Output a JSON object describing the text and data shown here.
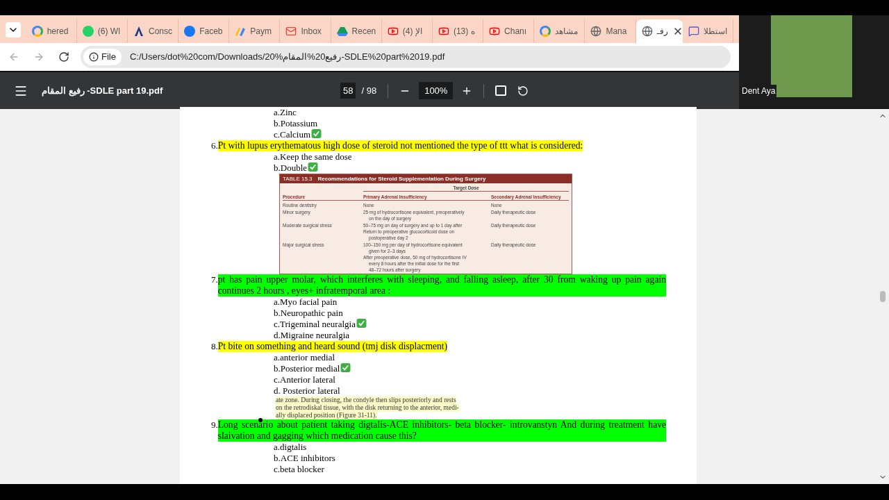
{
  "browser": {
    "tabs": [
      {
        "label": "hered",
        "selected": false
      },
      {
        "label": "(6) Wl",
        "selected": false
      },
      {
        "label": "Consc",
        "selected": false
      },
      {
        "label": "Faceb",
        "selected": false
      },
      {
        "label": "Paym",
        "selected": false
      },
      {
        "label": "Inbox",
        "selected": false
      },
      {
        "label": "Recen",
        "selected": false
      },
      {
        "label": "الإ (4)",
        "selected": false
      },
      {
        "label": "(13) ه",
        "selected": false
      },
      {
        "label": "Chanı",
        "selected": false
      },
      {
        "label": "مشاهد",
        "selected": false
      },
      {
        "label": "Mana",
        "selected": false
      },
      {
        "label": "رفـ",
        "selected": true
      },
      {
        "label": "استطلا",
        "selected": false
      }
    ],
    "address": {
      "scheme": "File",
      "url": "C:/Users/dot%20com/Downloads/20%رفيع20%المقام-SDLE%20part%2019.pdf"
    }
  },
  "viewer": {
    "title": "رفيع المقام -SDLE part 19.pdf",
    "page": "58",
    "page_total": "/ 98",
    "zoom": "100%"
  },
  "webcam": {
    "name": "Dent Aya"
  },
  "document": [
    {
      "kind": "option",
      "text": "a.Zinc",
      "correct": false
    },
    {
      "kind": "option",
      "text": "b.Potassium",
      "correct": false
    },
    {
      "kind": "option",
      "text": "c.Calcium",
      "correct": true
    },
    {
      "kind": "question",
      "number": "6.",
      "text": "Pt with lupus erythematous high dose of steroid not mentioned the type of ttt what is considered:",
      "color": "#ffff00"
    },
    {
      "kind": "option",
      "text": "a.Keep the same dose",
      "correct": false
    },
    {
      "kind": "option",
      "text": "b.Double",
      "correct": true
    },
    {
      "kind": "table",
      "title_label": "TABLE 15.3",
      "title": "Recommendations for Steroid Supplementation During Surgery",
      "group_heading": "Target Dose",
      "columns": [
        "Procedure",
        "Primary Adrenal Insufficiency",
        "Secondary Adrenal Insufficiency"
      ],
      "rows": [
        {
          "procedure": "Routine dentistry",
          "primary": [
            "None"
          ],
          "secondary": "None"
        },
        {
          "procedure": "Minor surgery",
          "primary": [
            "25 mg of hydrocortisone equivalent, preoperatively on the day of surgery"
          ],
          "secondary": "Daily therapeutic dose"
        },
        {
          "procedure": "Moderate surgical stress",
          "primary": [
            "50–75 mg on day of surgery and up to 1 day after",
            "Return to preoperative glucocorticoid dose on postoperative day 2"
          ],
          "secondary": "Daily therapeutic dose"
        },
        {
          "procedure": "Major surgical stress",
          "primary": [
            "100–150 mg per day of hydrocortisone equivalent given for 2–3 days",
            "After preoperative dose, 50 mg of hydrocortisone IV every 8 hours after the initial dose for the first 48–72 hours after surgery"
          ],
          "secondary": "Daily therapeutic dose"
        }
      ]
    },
    {
      "kind": "question",
      "number": "7.",
      "text": "pt has pain upper molar, which interferes with sleeping, and falling asleep, after 30 from waking up pain again continues 2 hours , eyes+ infratemporal area :",
      "color": "#00ff00"
    },
    {
      "kind": "option",
      "text": "a.Myo facial pain",
      "correct": false
    },
    {
      "kind": "option",
      "text": "b.Neuropathic pain",
      "correct": false
    },
    {
      "kind": "option",
      "text": "c.Trigeminal neuralgia",
      "correct": true
    },
    {
      "kind": "option",
      "text": "d.Migraine neuralgia",
      "correct": false
    },
    {
      "kind": "question",
      "number": "8.",
      "text": "Pt bite on something and heard sound (tmj disk displacment)",
      "color": "#ffff00"
    },
    {
      "kind": "option",
      "text": "a.anterior medial",
      "correct": false
    },
    {
      "kind": "option",
      "text": "b.Posterior medial",
      "correct": true
    },
    {
      "kind": "option",
      "text": "c.Anterior lateral",
      "correct": false
    },
    {
      "kind": "option",
      "text": "d. Posterior lateral",
      "correct": false
    },
    {
      "kind": "excerpt",
      "lines": [
        "ate zone. During closing, the condyle then slips posteriorly and rests",
        "on the retrodiskal tissue, with the disk returning to the anterior, medi-",
        "ally displaced position (Figure 31-11)."
      ]
    },
    {
      "kind": "question",
      "number": "9.",
      "text": "Long scenario about patient taking digtalis-ACE inhibitors- beta blocker- introvanstyn  And during treatment have slaivation and gagging which medication cause this?",
      "color": "#00ff00"
    },
    {
      "kind": "option",
      "text": "a.digtalis",
      "correct": false
    },
    {
      "kind": "option",
      "text": "b.ACE inhibitors",
      "correct": false
    },
    {
      "kind": "option",
      "text": "c.beta blocker",
      "correct": false
    }
  ]
}
